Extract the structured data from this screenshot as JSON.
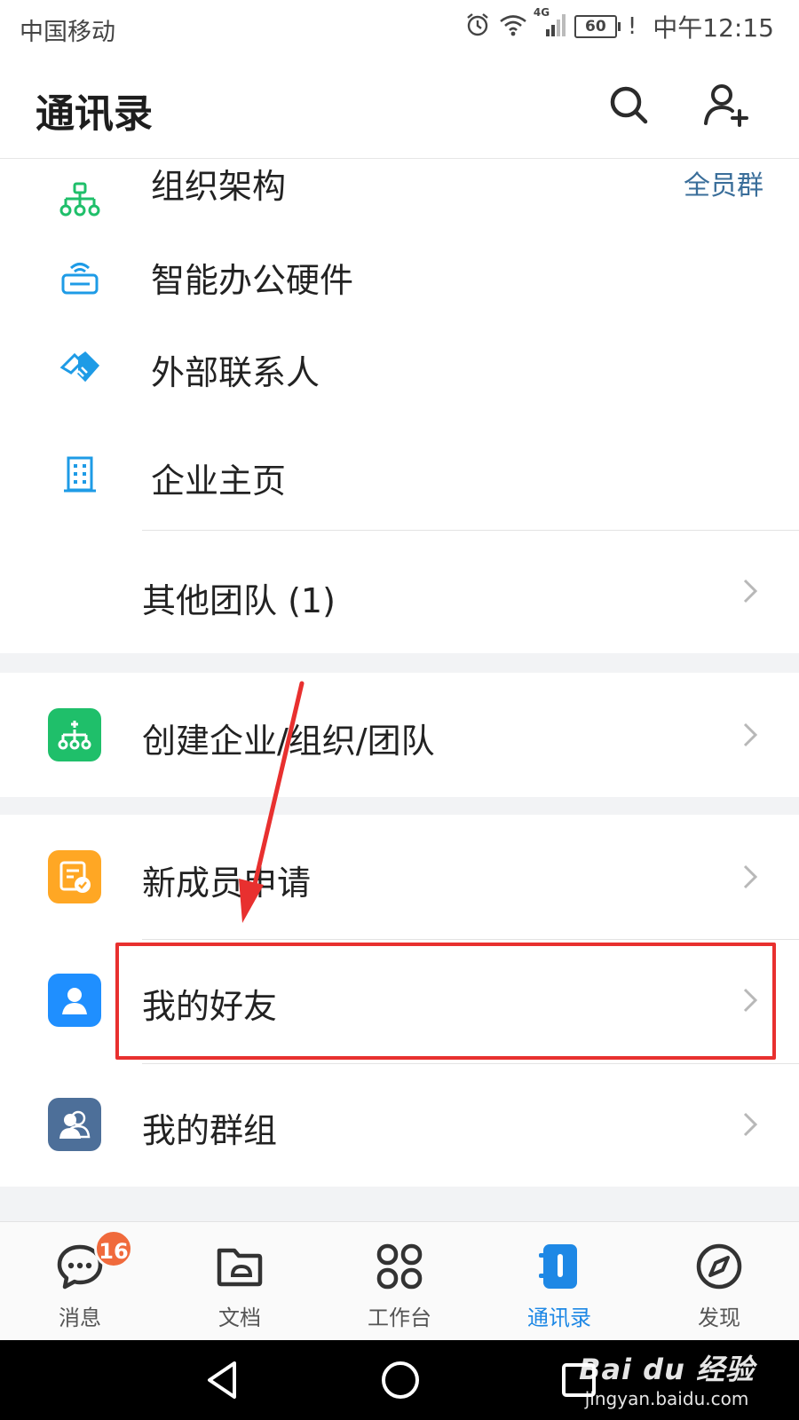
{
  "status_bar": {
    "carrier": "中国移动",
    "network": "4G",
    "battery": "60",
    "battery_warning": "!",
    "time": "中午12:15"
  },
  "header": {
    "title": "通讯录",
    "search_icon": "search-icon",
    "add_contact_icon": "add-contact-icon"
  },
  "org_section": {
    "items": [
      {
        "label": "组织架构",
        "icon": "org-chart-icon",
        "meta": "全员群"
      },
      {
        "label": "智能办公硬件",
        "icon": "smart-hardware-icon"
      },
      {
        "label": "外部联系人",
        "icon": "handshake-icon"
      },
      {
        "label": "企业主页",
        "icon": "building-icon"
      }
    ],
    "other_teams": "其他团队 (1)"
  },
  "create_section": {
    "label": "创建企业/组织/团队",
    "icon": "create-org-icon",
    "color": "#1fbf6a"
  },
  "people_section": {
    "items": [
      {
        "label": "新成员申请",
        "icon": "new-member-icon",
        "color": "#ffa724"
      },
      {
        "label": "我的好友",
        "icon": "friends-icon",
        "color": "#1f8fff"
      },
      {
        "label": "我的群组",
        "icon": "groups-icon",
        "color": "#4d6f99"
      }
    ]
  },
  "bottom_nav": {
    "items": [
      {
        "label": "消息",
        "icon": "message-icon",
        "badge": "16"
      },
      {
        "label": "文档",
        "icon": "folder-icon"
      },
      {
        "label": "工作台",
        "icon": "workbench-icon"
      },
      {
        "label": "通讯录",
        "icon": "contacts-icon",
        "active": true
      },
      {
        "label": "发现",
        "icon": "compass-icon"
      }
    ]
  },
  "watermark": {
    "main": "Bai du 经验",
    "sub": "jingyan.baidu.com"
  },
  "colors": {
    "accent": "#1e88e5",
    "highlight": "#e8302f",
    "badge": "#f06a3c"
  }
}
